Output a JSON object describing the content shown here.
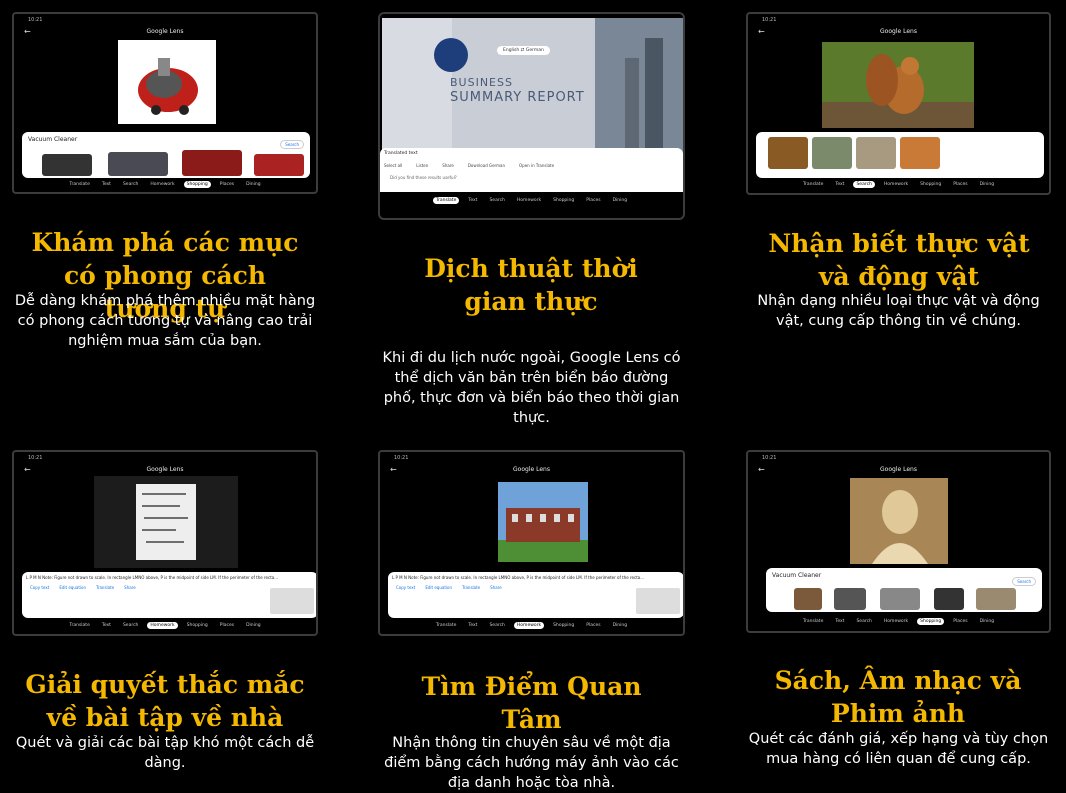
{
  "cards": [
    {
      "title": "Khám phá các mục có phong cách tương tự",
      "desc": "Dễ dàng khám phá thêm nhiều mặt hàng có phong cách tương tự và nâng cao trải nghiệm mua sắm của bạn.",
      "app": "Google Lens",
      "result_title": "Vacuum Cleaner",
      "active_tab": "Shopping"
    },
    {
      "title": "Dịch thuật thời gian thực",
      "desc": "Khi đi du lịch nước ngoài, Google Lens có thể dịch văn bản trên biển báo đường phố, thực đơn và biển báo theo thời gian thực.",
      "lang_from": "English",
      "lang_to": "German",
      "doc_line1": "BUSINESS",
      "doc_line2": "SUMMARY REPORT",
      "panel_label": "Translated text",
      "actions": [
        "Select all",
        "Listen",
        "Share",
        "Download German",
        "Open in Translate"
      ],
      "feedback": "Did you find these results useful?",
      "active_tab": "Translate"
    },
    {
      "title": "Nhận biết thực vật và động vật",
      "desc": "Nhận dạng nhiều loại thực vật và động vật, cung cấp thông tin về chúng.",
      "app": "Google Lens",
      "active_tab": "Search"
    },
    {
      "title": "Giải quyết thắc mắc về bài tập về nhà",
      "desc": "Quét và giải các bài tập khó một cách dễ dàng.",
      "app": "Google Lens",
      "question_text": "L P M N Note: Figure not drawn to scale. In rectangle LMNO above, P is the midpoint of side LM. If the perimeter of the recta...",
      "actions": [
        "Copy text",
        "Edit equation",
        "Translate",
        "Share"
      ],
      "active_tab": "Homework"
    },
    {
      "title": "Tìm Điểm Quan Tâm",
      "desc": "Nhận thông tin chuyên sâu về một địa điểm bằng cách hướng máy ảnh vào các địa danh hoặc tòa nhà.",
      "app": "Google Lens",
      "question_text": "L P M N Note: Figure not drawn to scale. In rectangle LMNO above, P is the midpoint of side LM. If the perimeter of the recta...",
      "actions": [
        "Copy text",
        "Edit equation",
        "Translate",
        "Share"
      ],
      "active_tab": "Homework"
    },
    {
      "title": "Sách, Âm nhạc và Phim ảnh",
      "desc": "Quét các đánh giá, xếp hạng và tùy chọn mua hàng có liên quan để cung cấp.",
      "app": "Google Lens",
      "result_title": "Vacuum Cleaner",
      "search_label": "Search",
      "active_tab": "Shopping"
    }
  ],
  "tabs": [
    "Translate",
    "Text",
    "Search",
    "Homework",
    "Shopping",
    "Places",
    "Dining"
  ],
  "status_time": "10:21",
  "accent_color": "#f5b800"
}
